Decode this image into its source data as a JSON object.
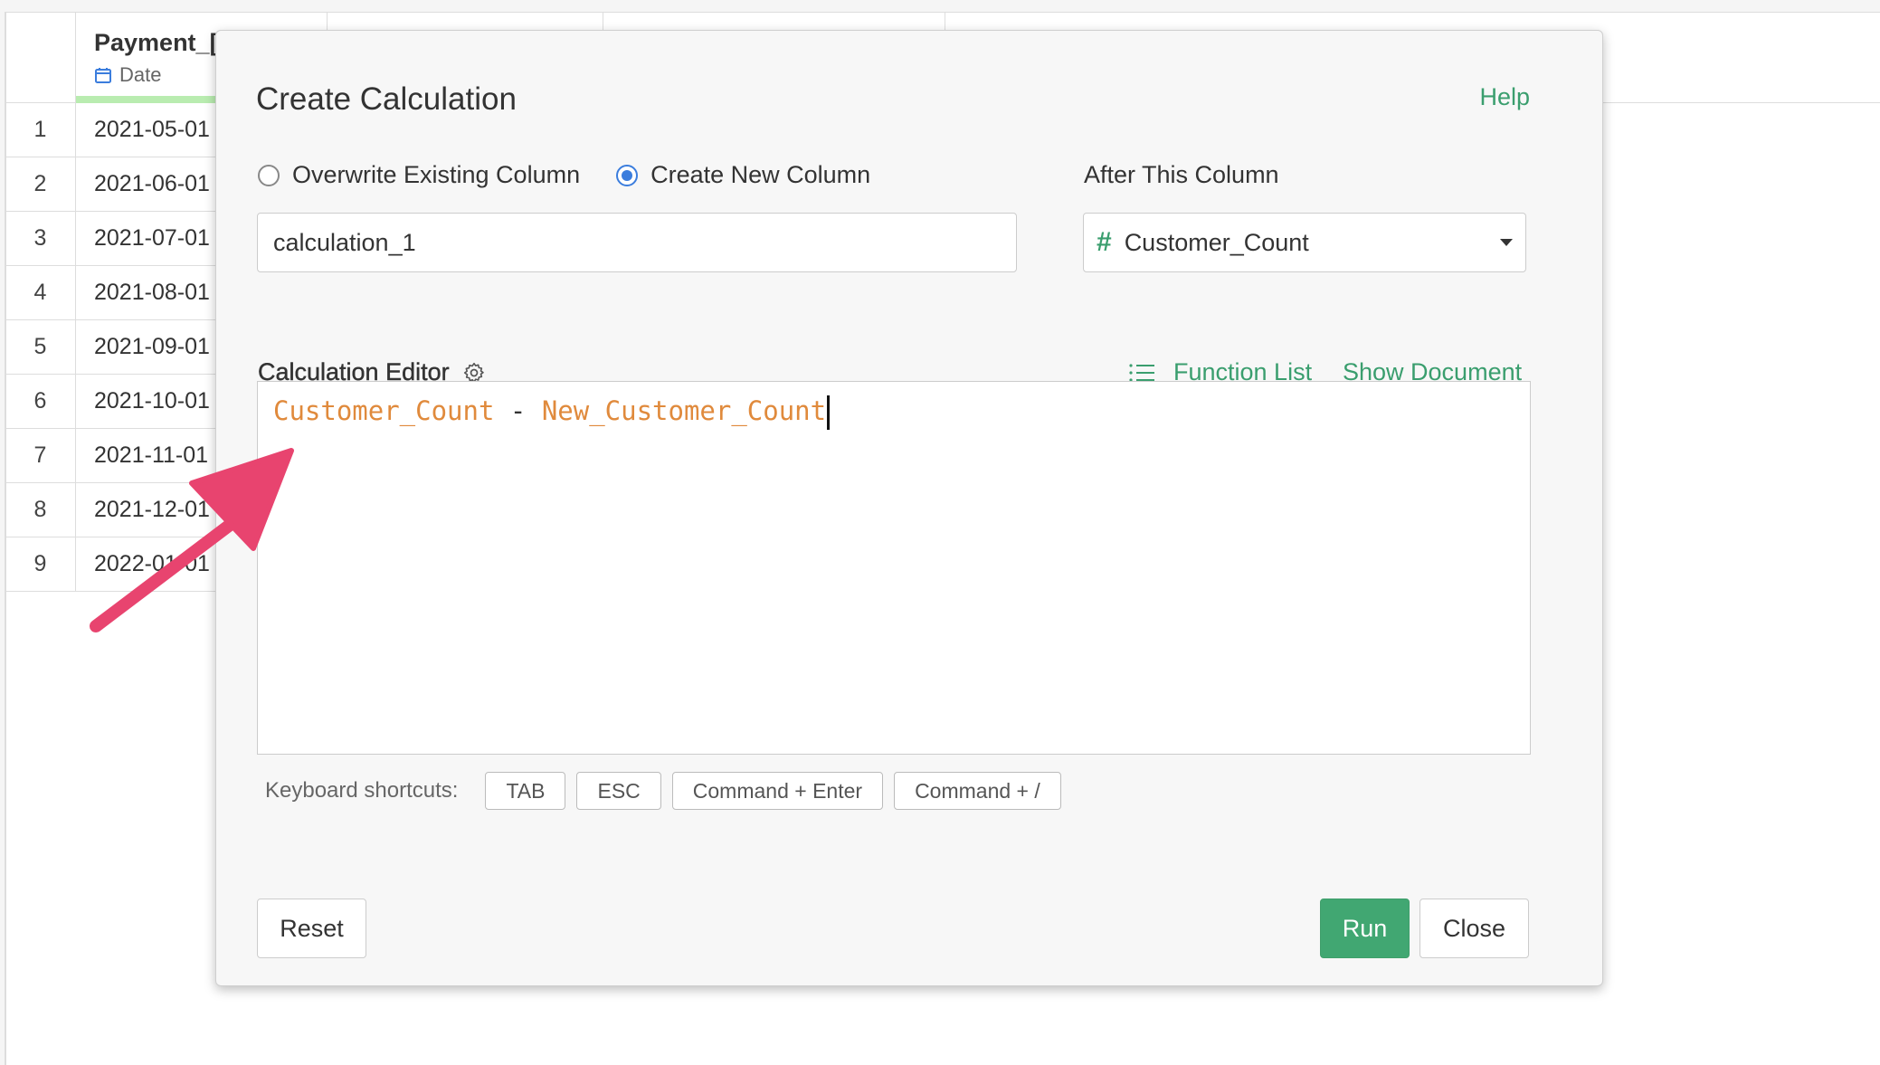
{
  "grid": {
    "column_title": "Payment_[",
    "column_type": "Date",
    "rows": [
      {
        "num": "1",
        "value": "2021-05-01"
      },
      {
        "num": "2",
        "value": "2021-06-01"
      },
      {
        "num": "3",
        "value": "2021-07-01"
      },
      {
        "num": "4",
        "value": "2021-08-01"
      },
      {
        "num": "5",
        "value": "2021-09-01"
      },
      {
        "num": "6",
        "value": "2021-10-01"
      },
      {
        "num": "7",
        "value": "2021-11-01"
      },
      {
        "num": "8",
        "value": "2021-12-01"
      },
      {
        "num": "9",
        "value": "2022-01-01"
      }
    ]
  },
  "dialog": {
    "title": "Create Calculation",
    "help_label": "Help",
    "radio_overwrite": "Overwrite Existing Column",
    "radio_create": "Create New Column",
    "selected_mode": "Create New Column",
    "new_column_name": "calculation_1",
    "after_label": "After This Column",
    "after_value": "Customer_Count",
    "editor_label": "Calculation Editor",
    "function_list_label": "Function List",
    "show_document_label": "Show Document",
    "expression": {
      "field_1": "Customer_Count",
      "operator": " - ",
      "field_2": "New_Customer_Count"
    },
    "shortcuts_label": "Keyboard shortcuts:",
    "shortcuts": [
      "TAB",
      "ESC",
      "Command + Enter",
      "Command + /"
    ],
    "reset_label": "Reset",
    "run_label": "Run",
    "close_label": "Close"
  },
  "colors": {
    "accent_green": "#41a772",
    "link_green": "#3a9e6e",
    "field_orange": "#e08a3c",
    "radio_blue": "#3b7ddd",
    "arrow_pink": "#e8446f"
  }
}
